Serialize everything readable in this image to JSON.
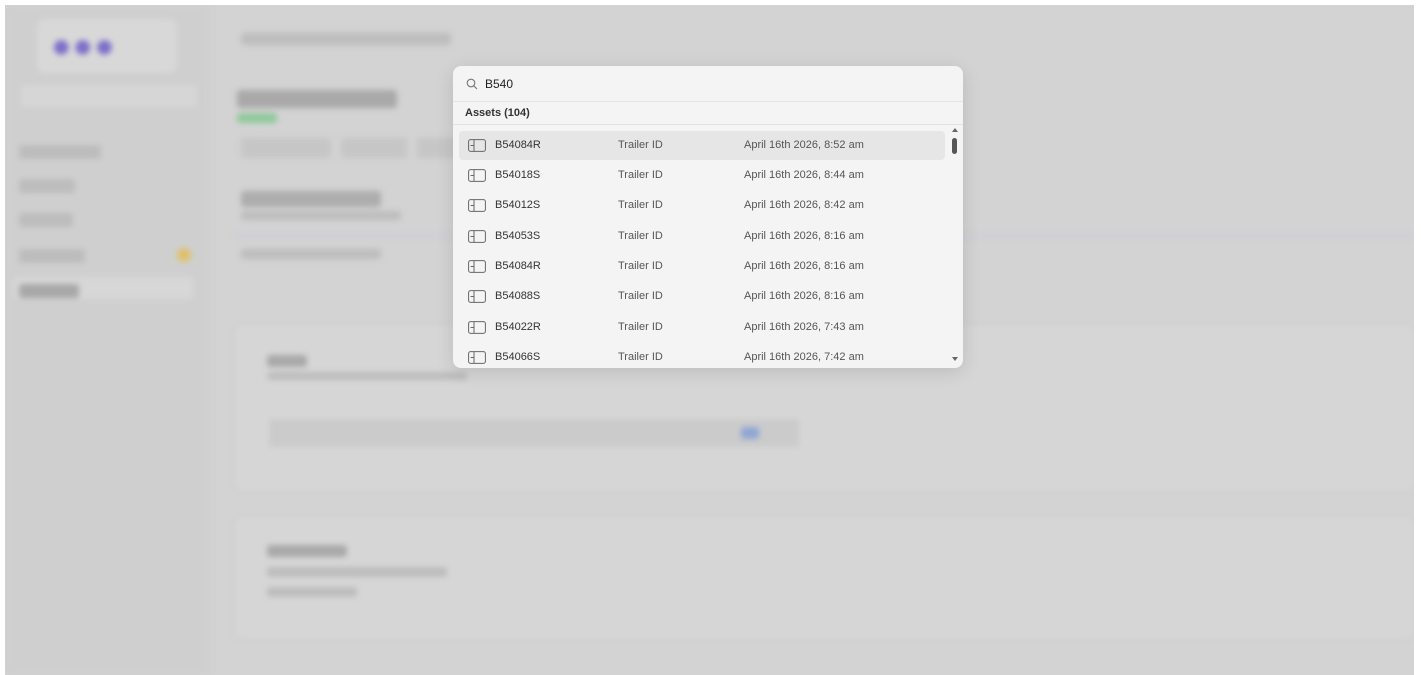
{
  "search": {
    "value": "B540",
    "icon": "search-icon"
  },
  "results": {
    "section_title": "Assets (104)",
    "items": [
      {
        "id": "B54084R",
        "type": "Trailer ID",
        "date": "April 16th 2026, 8:52 am"
      },
      {
        "id": "B54018S",
        "type": "Trailer ID",
        "date": "April 16th 2026, 8:44 am"
      },
      {
        "id": "B54012S",
        "type": "Trailer ID",
        "date": "April 16th 2026, 8:42 am"
      },
      {
        "id": "B54053S",
        "type": "Trailer ID",
        "date": "April 16th 2026, 8:16 am"
      },
      {
        "id": "B54084R",
        "type": "Trailer ID",
        "date": "April 16th 2026, 8:16 am"
      },
      {
        "id": "B54088S",
        "type": "Trailer ID",
        "date": "April 16th 2026, 8:16 am"
      },
      {
        "id": "B54022R",
        "type": "Trailer ID",
        "date": "April 16th 2026, 7:43 am"
      },
      {
        "id": "B54066S",
        "type": "Trailer ID",
        "date": "April 16th 2026, 7:42 am"
      }
    ],
    "item_icon": "trailer-icon"
  },
  "colors": {
    "overlay": "#d3d3d3",
    "popup_bg": "#f4f4f4",
    "selected_row": "#e6e6e6"
  }
}
